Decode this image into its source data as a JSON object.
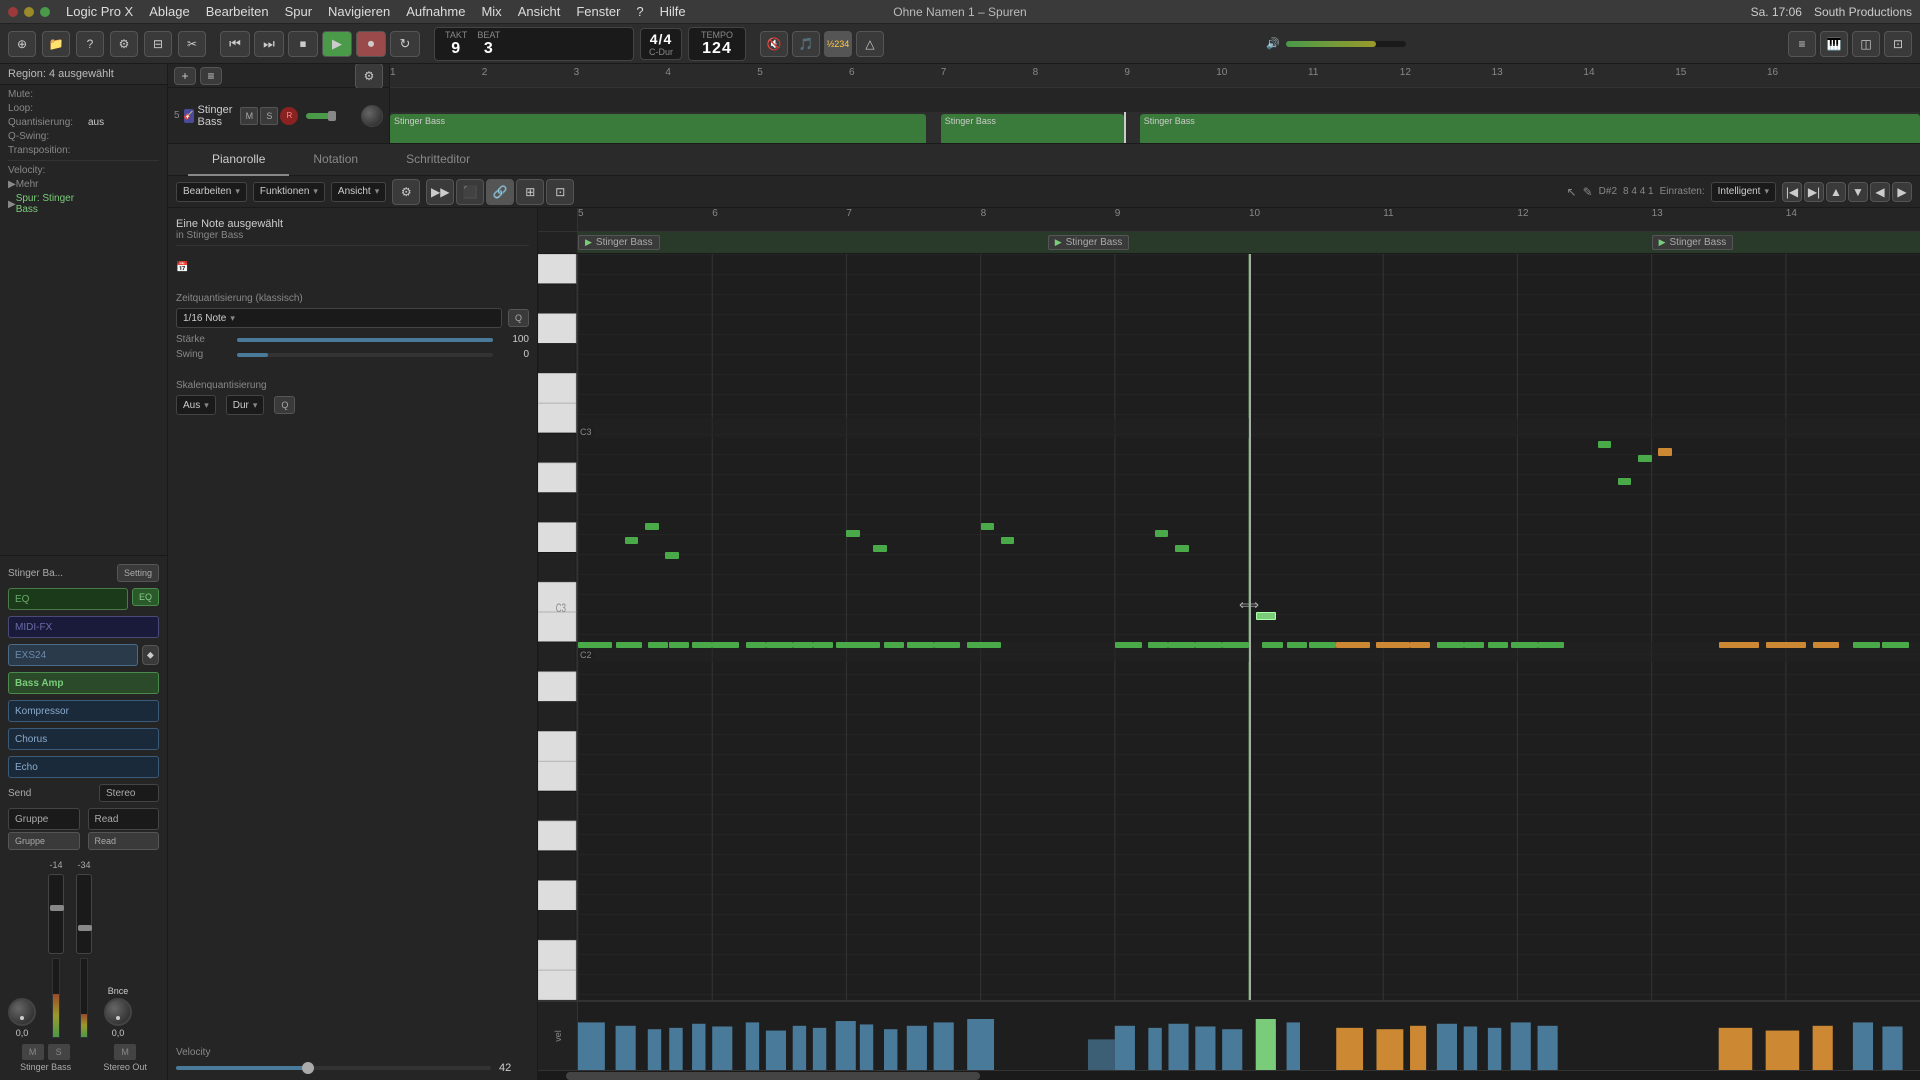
{
  "app": {
    "name": "Logic Pro X",
    "window_title": "Ohne Namen 1 – Spuren",
    "menu_items": [
      "Logic Pro X",
      "Ablage",
      "Bearbeiten",
      "Spur",
      "Navigieren",
      "Aufnahme",
      "Mix",
      "Ansicht",
      "Fenster",
      "?",
      "Hilfe"
    ],
    "time": "Sa. 17:06",
    "studio_name": "South Productions"
  },
  "toolbar": {
    "position": {
      "takt": "9",
      "beat": "3",
      "label_takt": "TAKT",
      "label_beat": "BEAT"
    },
    "tempo": {
      "value": "124",
      "label": "TEMPO"
    },
    "time_sig": {
      "value": "4/4",
      "key": "C-Dur"
    },
    "master_volume_pct": 75,
    "buttons": [
      "new",
      "open",
      "help",
      "settings",
      "trim",
      "scissors"
    ]
  },
  "transport": {
    "rewind": "⏮",
    "fast_forward": "⏭",
    "stop": "⏹",
    "play": "▶",
    "record": "⏺",
    "cycle": "↻"
  },
  "tracks_panel": {
    "region_label": "Region: 4 ausgewählt",
    "mute_label": "Mute:",
    "loop_label": "Loop:",
    "quantize_label": "Quantisierung:",
    "quantize_value": "aus",
    "q_swing_label": "Q-Swing:",
    "transpose_label": "Transposition:",
    "velocity_label": "Velocity:",
    "mehr_label": "Mehr",
    "spur_label": "Spur: Stinger Bass",
    "track_name": "Stinger Bass"
  },
  "track_header": {
    "name": "Stinger Bass",
    "mute": "M",
    "solo": "S",
    "record": "R"
  },
  "piano_roll": {
    "tabs": [
      "Pianorolle",
      "Notation",
      "Schritteditor"
    ],
    "active_tab": "Pianorolle",
    "selected_note_info": "Eine Note ausgewählt",
    "in_track": "in Stinger Bass",
    "note_display": "D#2",
    "beat_display": "8 4 4 1",
    "einrasten_label": "Einrasten:",
    "einrasten_value": "Intelligent",
    "pr_toolbar_buttons": [
      "Bearbeiten",
      "Funktionen",
      "Ansicht"
    ]
  },
  "quantize_panel": {
    "title": "Zeitquantisierung (klassisch)",
    "note_value": "1/16 Note",
    "q_label": "Q",
    "starke_label": "Stärke",
    "starke_value": 100,
    "swing_label": "Swing",
    "swing_value": 0,
    "scale_title": "Skalenquantisierung",
    "scale_aus": "Aus",
    "scale_dur": "Dur"
  },
  "velocity_panel": {
    "label": "Velocity",
    "value": 42,
    "pct": 42
  },
  "plugin_chain": {
    "instrument": "Stinger Ba...",
    "setting_btn": "Setting",
    "eq_label": "EQ",
    "eq_btn": "EQ",
    "midi_fx": "MIDI-FX",
    "exs_label": "EXS24",
    "aux_icon": "⬥",
    "bass_amp": "Bass Amp",
    "compressor": "Kompressor",
    "chorus": "Chorus",
    "echo": "Echo",
    "send_label": "Send",
    "stereo_label": "Stereo",
    "gruppe_label": "Gruppe",
    "gruppe_btn": "Gruppe",
    "read_label": "Read",
    "read_btn": "Read"
  },
  "channel_strip": {
    "knob1_label": "",
    "knob1_value": "0,0",
    "knob2_label": "",
    "knob2_value": "0,0",
    "fader1_val": "-14",
    "fader2_val": "-34",
    "bnce_label": "Bnce",
    "mute": "M",
    "solo": "S",
    "track_out": "Stinger Bass",
    "bus_out": "Stereo Out",
    "meter1_pct": 55,
    "meter2_pct": 30
  },
  "regions": [
    {
      "id": "r1",
      "label": "Stinger Bass",
      "left_pct": 0,
      "width_pct": 37
    },
    {
      "id": "r2",
      "label": "Stinger Bass",
      "left_pct": 37.5,
      "width_pct": 23
    },
    {
      "id": "r3",
      "label": "Stinger Bass",
      "left_pct": 62,
      "width_pct": 38
    }
  ],
  "pr_regions": [
    {
      "id": "pr1",
      "label": "Stinger Bass",
      "left_pct": 0,
      "width_pct": 35
    },
    {
      "id": "pr2",
      "label": "Stinger Bass",
      "left_pct": 35.5,
      "width_pct": 24
    },
    {
      "id": "pr3",
      "label": "Stinger Bass",
      "left_pct": 81,
      "width_pct": 19
    }
  ],
  "ruler_marks": [
    "5",
    "6",
    "7",
    "8",
    "9",
    "10",
    "11",
    "12",
    "13",
    "14"
  ],
  "top_ruler_marks": [
    "1",
    "2",
    "3",
    "4",
    "5",
    "6",
    "7",
    "8",
    "9",
    "10",
    "11",
    "12",
    "13",
    "14",
    "15",
    "16"
  ],
  "colors": {
    "accent_green": "#4aaa4a",
    "bg_dark": "#1e1e1e",
    "bg_mid": "#252525",
    "bg_light": "#2d2d2d",
    "region_green": "#3a7a3a",
    "note_orange": "#cc8833",
    "selected_note": "#7acc7a"
  }
}
